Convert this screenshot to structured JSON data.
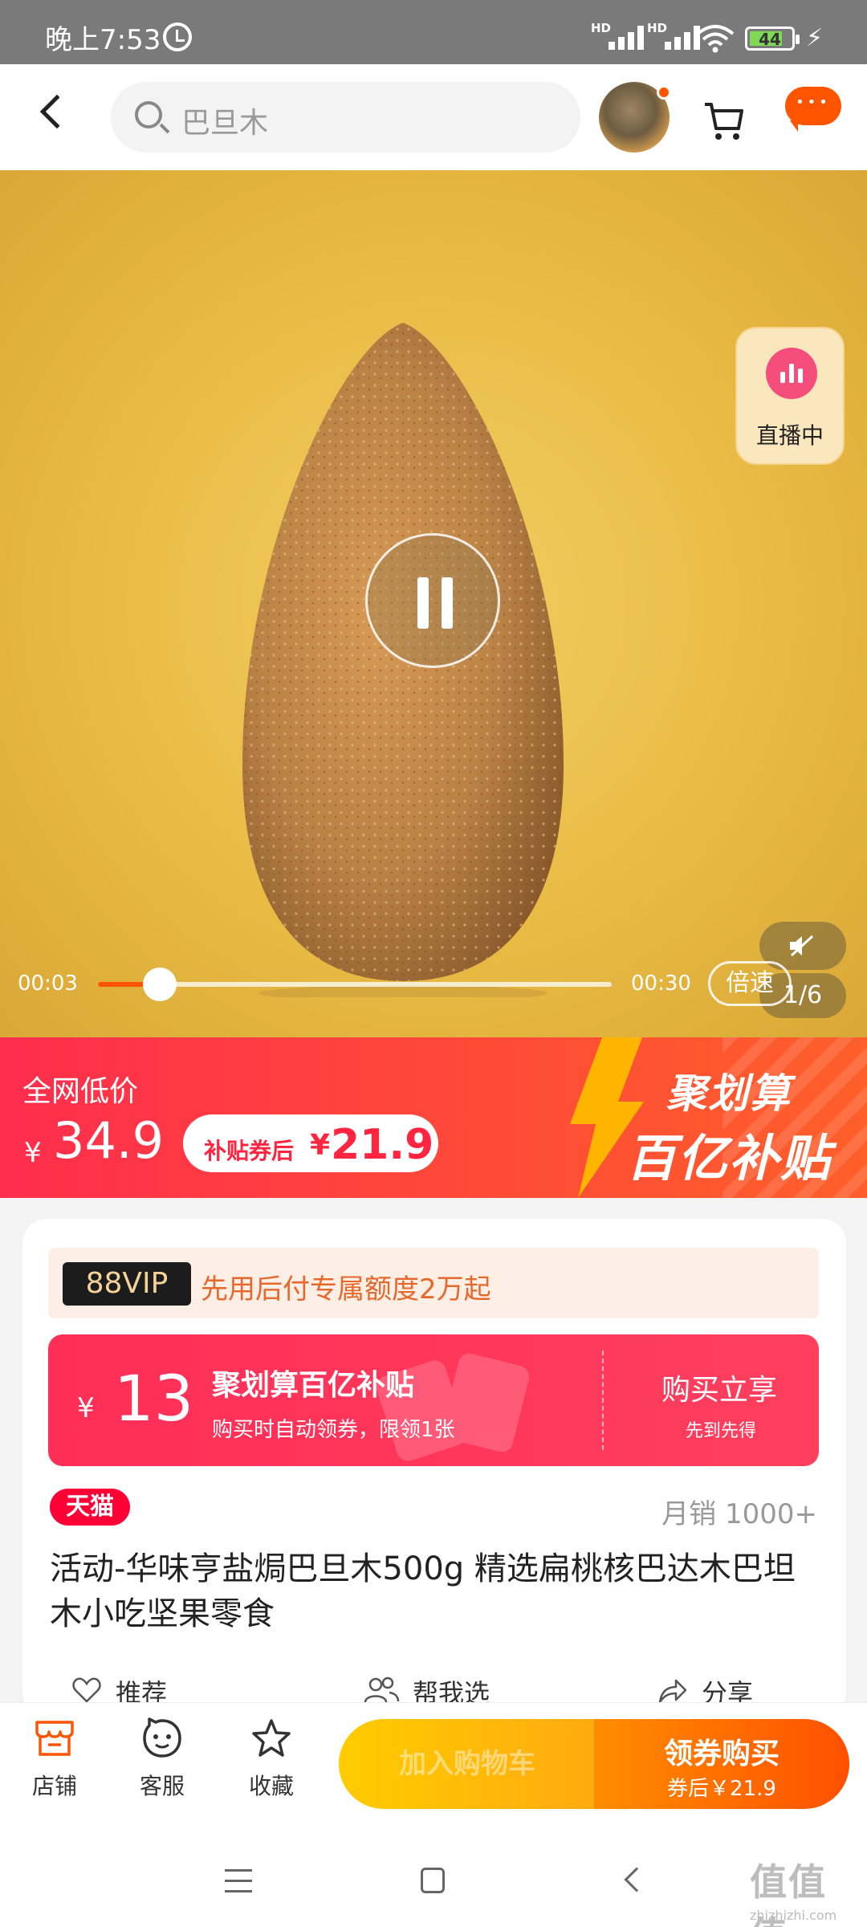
{
  "status_bar": {
    "time": "晚上7:53",
    "signal1": "HD",
    "signal2": "HD",
    "battery": "44"
  },
  "header": {
    "search_text": "巴旦木"
  },
  "video": {
    "live_label": "直播中",
    "current_time": "00:03",
    "total_time": "00:30",
    "progress": 0.12,
    "speed_label": "倍速",
    "page_indicator": "1/6"
  },
  "price_banner": {
    "label": "全网低价",
    "currency": "¥",
    "price": "34.9",
    "coupon_text": "补贴券后",
    "coupon_currency": "¥",
    "coupon_price": "21.9",
    "promo_line1": "聚划算",
    "promo_line2": "百亿补贴"
  },
  "card": {
    "vip_badge": "88VIP",
    "vip_text": "先用后付专属额度2万起",
    "subsidy": {
      "currency": "¥",
      "amount": "13",
      "title": "聚划算百亿补贴",
      "desc": "购买时自动领券，限领1张",
      "action": "购买立享",
      "action_sub": "先到先得"
    },
    "store_badge": "天猫",
    "sales": "月销 1000+",
    "product_title": "活动-华味亨盐焗巴旦木500g 精选扁桃核巴达木巴坦木小吃坚果零食",
    "actions": {
      "recommend": "推荐",
      "help_choose": "帮我选",
      "share": "分享"
    }
  },
  "bottom_bar": {
    "store": "店铺",
    "service": "客服",
    "favorite": "收藏",
    "add_cart": "加入购物车",
    "buy": "领券购买",
    "buy_sub": "券后￥21.9"
  },
  "watermark": {
    "text": "值值值",
    "url": "zhizhizhi.com"
  },
  "colors": {
    "brand_orange": "#ff5500",
    "banner_red": "#ff2d4d",
    "tmall_red": "#ff0036",
    "subsidy_pink": "#ff2e57"
  }
}
